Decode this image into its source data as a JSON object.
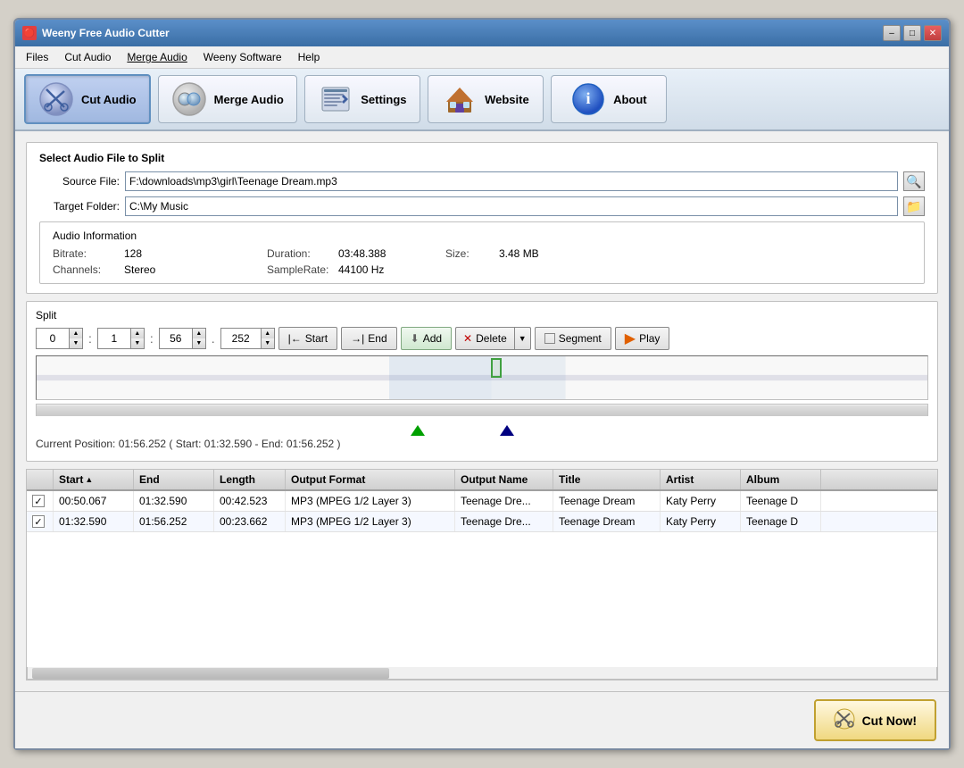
{
  "window": {
    "title": "Weeny Free Audio Cutter",
    "icon": "🎵"
  },
  "titlebar": {
    "minimize": "–",
    "maximize": "□",
    "close": "✕"
  },
  "menu": {
    "items": [
      "Files",
      "Cut Audio",
      "Merge Audio",
      "Weeny Software",
      "Help"
    ]
  },
  "toolbar": {
    "buttons": [
      {
        "id": "cut-audio",
        "label": "Cut Audio",
        "icon": "✂️",
        "active": true
      },
      {
        "id": "merge-audio",
        "label": "Merge Audio",
        "icon": "💿",
        "active": false
      },
      {
        "id": "settings",
        "label": "Settings",
        "icon": "📋",
        "active": false
      },
      {
        "id": "website",
        "label": "Website",
        "icon": "🏠",
        "active": false
      },
      {
        "id": "about",
        "label": "About",
        "icon": "ℹ️",
        "active": false
      }
    ]
  },
  "file_select": {
    "section_title": "Select Audio File to Split",
    "source_label": "Source File:",
    "source_value": "F:\\downloads\\mp3\\girl\\Teenage Dream.mp3",
    "target_label": "Target Folder:",
    "target_value": "C:\\My Music"
  },
  "audio_info": {
    "section_title": "Audio Information",
    "bitrate_label": "Bitrate:",
    "bitrate_value": "128",
    "channels_label": "Channels:",
    "channels_value": "Stereo",
    "duration_label": "Duration:",
    "duration_value": "03:48.388",
    "samplerate_label": "SampleRate:",
    "samplerate_value": "44100 Hz",
    "size_label": "Size:",
    "size_value": "3.48 MB"
  },
  "split": {
    "section_title": "Split",
    "time_h": "0",
    "time_m": "1",
    "time_s": "56",
    "time_ms": "252",
    "buttons": {
      "start": "Start",
      "end": "End",
      "add": "Add",
      "delete": "Delete",
      "segment": "Segment",
      "play": "Play"
    },
    "current_position": "Current Position: 01:56.252 ( Start: 01:32.590 - End: 01:56.252 )"
  },
  "table": {
    "columns": [
      "",
      "Start",
      "End",
      "Length",
      "Output Format",
      "Output Name",
      "Title",
      "Artist",
      "Album"
    ],
    "rows": [
      {
        "checked": true,
        "start": "00:50.067",
        "end": "01:32.590",
        "length": "00:42.523",
        "format": "MP3 (MPEG 1/2 Layer 3)",
        "output_name": "Teenage Dre...",
        "title": "Teenage Dream",
        "artist": "Katy Perry",
        "album": "Teenage D"
      },
      {
        "checked": true,
        "start": "01:32.590",
        "end": "01:56.252",
        "length": "00:23.662",
        "format": "MP3 (MPEG 1/2 Layer 3)",
        "output_name": "Teenage Dre...",
        "title": "Teenage Dream",
        "artist": "Katy Perry",
        "album": "Teenage D"
      }
    ]
  },
  "bottom": {
    "cut_now_label": "Cut Now!"
  }
}
